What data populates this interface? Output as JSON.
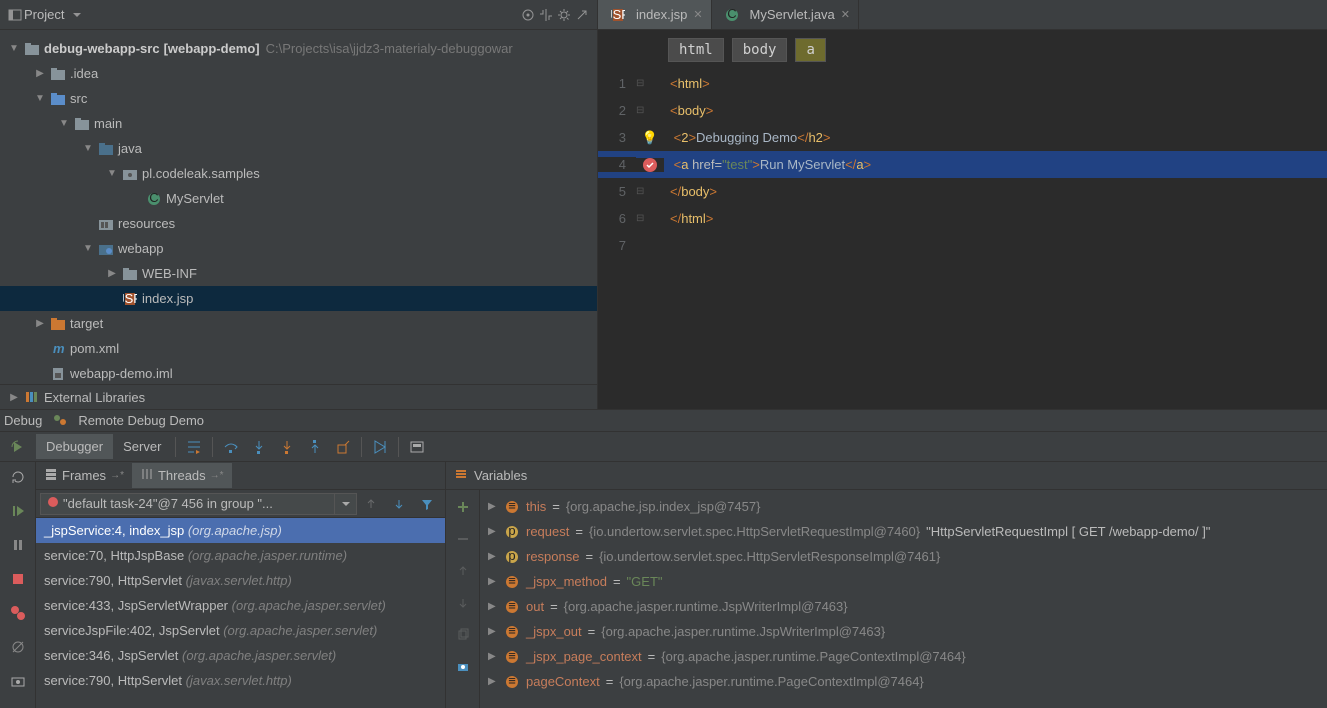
{
  "project_header": {
    "title": "Project"
  },
  "tree": {
    "root": {
      "name": "debug-webapp-src",
      "module": "[webapp-demo]",
      "path": "C:\\Projects\\isa\\jjdz3-materialy-debuggowar"
    },
    "idea": ".idea",
    "src": "src",
    "main": "main",
    "java": "java",
    "pkg": "pl.codeleak.samples",
    "servlet": "MyServlet",
    "resources": "resources",
    "webapp": "webapp",
    "webinf": "WEB-INF",
    "indexjsp": "index.jsp",
    "target": "target",
    "pom": "pom.xml",
    "iml": "webapp-demo.iml",
    "extlib": "External Libraries"
  },
  "editor": {
    "tabs": [
      {
        "label": "index.jsp",
        "active": true,
        "icon": "jsp"
      },
      {
        "label": "MyServlet.java",
        "active": false,
        "icon": "class"
      }
    ],
    "breadcrumb": [
      "html",
      "body",
      "a"
    ],
    "lines": {
      "l1": {
        "n": "1"
      },
      "l2": {
        "n": "2"
      },
      "l3": {
        "n": "3",
        "text": "Debugging Demo"
      },
      "l4": {
        "n": "4",
        "href": "\"test\"",
        "link": "Run MyServlet"
      },
      "l5": {
        "n": "5"
      },
      "l6": {
        "n": "6"
      },
      "l7": {
        "n": "7"
      }
    }
  },
  "debug": {
    "label": "Debug",
    "config": "Remote Debug Demo",
    "tabs": {
      "debugger": "Debugger",
      "server": "Server"
    },
    "frames_tab": "Frames",
    "threads_tab": "Threads",
    "thread": "\"default task-24\"@7 456 in group \"...",
    "frames": [
      {
        "m": "_jspService:4, index_jsp",
        "p": "(org.apache.jsp)",
        "sel": true
      },
      {
        "m": "service:70, HttpJspBase",
        "p": "(org.apache.jasper.runtime)"
      },
      {
        "m": "service:790, HttpServlet",
        "p": "(javax.servlet.http)"
      },
      {
        "m": "service:433, JspServletWrapper",
        "p": "(org.apache.jasper.servlet)"
      },
      {
        "m": "serviceJspFile:402, JspServlet",
        "p": "(org.apache.jasper.servlet)"
      },
      {
        "m": "service:346, JspServlet",
        "p": "(org.apache.jasper.servlet)"
      },
      {
        "m": "service:790, HttpServlet",
        "p": "(javax.servlet.http)"
      }
    ],
    "vars_title": "Variables",
    "vars": [
      {
        "icon": "f",
        "name": "this",
        "val": "{org.apache.jsp.index_jsp@7457}"
      },
      {
        "icon": "p",
        "name": "request",
        "val": "{io.undertow.servlet.spec.HttpServletRequestImpl@7460}",
        "extra": "\"HttpServletRequestImpl [ GET /webapp-demo/ ]\""
      },
      {
        "icon": "p",
        "name": "response",
        "val": "{io.undertow.servlet.spec.HttpServletResponseImpl@7461}"
      },
      {
        "icon": "f",
        "name": "_jspx_method",
        "str": "\"GET\""
      },
      {
        "icon": "f",
        "name": "out",
        "val": "{org.apache.jasper.runtime.JspWriterImpl@7463}"
      },
      {
        "icon": "f",
        "name": "_jspx_out",
        "val": "{org.apache.jasper.runtime.JspWriterImpl@7463}"
      },
      {
        "icon": "f",
        "name": "_jspx_page_context",
        "val": "{org.apache.jasper.runtime.PageContextImpl@7464}"
      },
      {
        "icon": "f",
        "name": "pageContext",
        "val": "{org.apache.jasper.runtime.PageContextImpl@7464}"
      }
    ]
  }
}
